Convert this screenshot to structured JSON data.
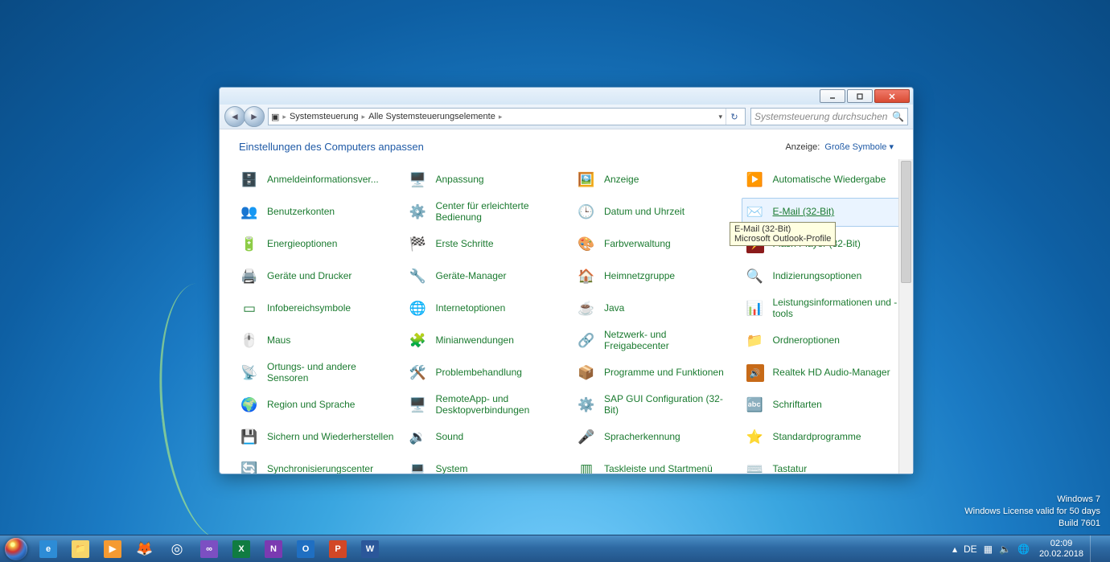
{
  "window": {
    "breadcrumb": [
      "Systemsteuerung",
      "Alle Systemsteuerungselemente"
    ],
    "search_placeholder": "Systemsteuerung durchsuchen",
    "heading": "Einstellungen des Computers anpassen",
    "view_label": "Anzeige:",
    "view_value": "Große Symbole"
  },
  "items": [
    {
      "label": "Anmeldeinformationsver...",
      "icon": "🗄️"
    },
    {
      "label": "Anpassung",
      "icon": "🖥️"
    },
    {
      "label": "Anzeige",
      "icon": "🖼️"
    },
    {
      "label": "Automatische Wiedergabe",
      "icon": "▶️"
    },
    {
      "label": "Benutzerkonten",
      "icon": "👥"
    },
    {
      "label": "Center für erleichterte Bedienung",
      "icon": "⚙️"
    },
    {
      "label": "Datum und Uhrzeit",
      "icon": "🕒"
    },
    {
      "label": "E-Mail (32-Bit)",
      "icon": "✉️",
      "highlight": true
    },
    {
      "label": "Energieoptionen",
      "icon": "🔋"
    },
    {
      "label": "Erste Schritte",
      "icon": "🏁"
    },
    {
      "label": "Farbverwaltung",
      "icon": "🎨"
    },
    {
      "label": "Flash Player (32-Bit)",
      "icon": "⚡",
      "iconbg": "#8b1b1b"
    },
    {
      "label": "Geräte und Drucker",
      "icon": "🖨️"
    },
    {
      "label": "Geräte-Manager",
      "icon": "🔧"
    },
    {
      "label": "Heimnetzgruppe",
      "icon": "🏠"
    },
    {
      "label": "Indizierungsoptionen",
      "icon": "🔍"
    },
    {
      "label": "Infobereichsymbole",
      "icon": "▭"
    },
    {
      "label": "Internetoptionen",
      "icon": "🌐"
    },
    {
      "label": "Java",
      "icon": "☕"
    },
    {
      "label": "Leistungsinformationen und -tools",
      "icon": "📊"
    },
    {
      "label": "Maus",
      "icon": "🖱️"
    },
    {
      "label": "Minianwendungen",
      "icon": "🧩"
    },
    {
      "label": "Netzwerk- und Freigabecenter",
      "icon": "🔗"
    },
    {
      "label": "Ordneroptionen",
      "icon": "📁"
    },
    {
      "label": "Ortungs- und andere Sensoren",
      "icon": "📡"
    },
    {
      "label": "Problembehandlung",
      "icon": "🛠️"
    },
    {
      "label": "Programme und Funktionen",
      "icon": "📦"
    },
    {
      "label": "Realtek HD Audio-Manager",
      "icon": "🔊",
      "iconbg": "#c76a18"
    },
    {
      "label": "Region und Sprache",
      "icon": "🌍"
    },
    {
      "label": "RemoteApp- und Desktopverbindungen",
      "icon": "🖥️"
    },
    {
      "label": "SAP GUI Configuration (32-Bit)",
      "icon": "⚙️"
    },
    {
      "label": "Schriftarten",
      "icon": "🔤"
    },
    {
      "label": "Sichern und Wiederherstellen",
      "icon": "💾"
    },
    {
      "label": "Sound",
      "icon": "🔉"
    },
    {
      "label": "Spracherkennung",
      "icon": "🎤"
    },
    {
      "label": "Standardprogramme",
      "icon": "⭐"
    },
    {
      "label": "Synchronisierungscenter",
      "icon": "🔄"
    },
    {
      "label": "System",
      "icon": "💻"
    },
    {
      "label": "Taskleiste und Startmenü",
      "icon": "▥"
    },
    {
      "label": "Tastatur",
      "icon": "⌨️"
    }
  ],
  "tooltip": {
    "title": "E-Mail (32-Bit)",
    "desc": "Microsoft Outlook-Profile"
  },
  "watermark": {
    "l1": "Windows 7",
    "l2": "Windows License valid for 50 days",
    "l3": "Build 7601"
  },
  "taskbar": [
    {
      "name": "ie-icon",
      "glyph": "e",
      "bg": "#2d8cd6"
    },
    {
      "name": "explorer-icon",
      "glyph": "📁",
      "bg": "#f7d56a"
    },
    {
      "name": "mediaplayer-icon",
      "glyph": "▶",
      "bg": "#f59a32"
    },
    {
      "name": "firefox-icon",
      "glyph": "🦊",
      "bg": ""
    },
    {
      "name": "chrome-icon",
      "glyph": "◎",
      "bg": ""
    },
    {
      "name": "vs-icon",
      "glyph": "∞",
      "bg": "#7c4fc2"
    },
    {
      "name": "excel-icon",
      "glyph": "X",
      "bg": "#107c41"
    },
    {
      "name": "onenote-icon",
      "glyph": "N",
      "bg": "#7b3ab1"
    },
    {
      "name": "outlook-icon",
      "glyph": "O",
      "bg": "#1f6fc2"
    },
    {
      "name": "powerpoint-icon",
      "glyph": "P",
      "bg": "#d24726"
    },
    {
      "name": "word-icon",
      "glyph": "W",
      "bg": "#2b579a"
    }
  ],
  "tray": {
    "lang": "DE",
    "time": "02:09",
    "date": "20.02.2018"
  }
}
